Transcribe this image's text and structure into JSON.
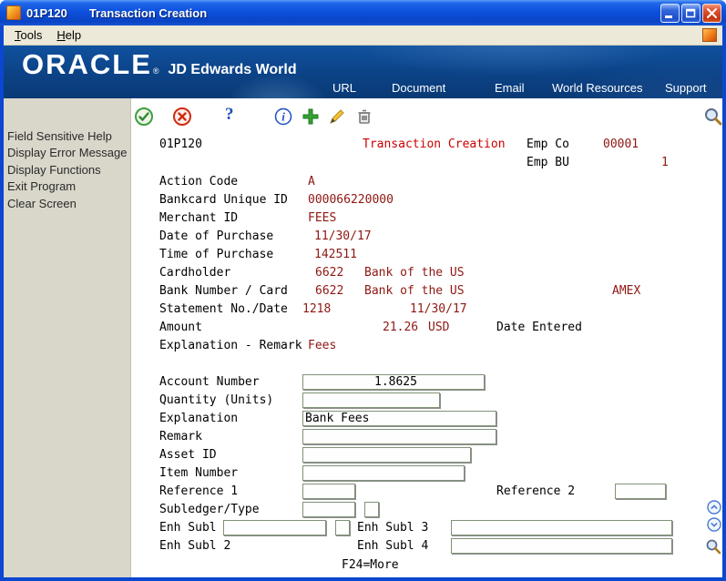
{
  "titlebar": {
    "program": "01P120",
    "title": "Transaction Creation",
    "buttons": [
      "minimize",
      "maximize",
      "close"
    ]
  },
  "menubar": {
    "items": [
      "Tools",
      "Help"
    ]
  },
  "banner": {
    "logo": "ORACLE",
    "trademark": "®",
    "product": "JD Edwards World",
    "links": [
      "URL",
      "Document",
      "Email",
      "World Resources",
      "Support"
    ]
  },
  "sidebar": {
    "items": [
      "Field Sensitive Help",
      "Display Error Message",
      "Display Functions",
      "Exit Program",
      "Clear Screen"
    ]
  },
  "toolbar": {
    "icons": [
      "approve",
      "cancel",
      "help",
      "info",
      "add",
      "edit",
      "delete",
      "search"
    ]
  },
  "screen": {
    "program_id": "01P120",
    "title": "Transaction Creation",
    "emp_co": {
      "label": "Emp Co",
      "value": "00001"
    },
    "emp_bu": {
      "label": "Emp BU",
      "value": "1"
    },
    "rows": {
      "action_code": {
        "label": "Action Code",
        "value": "A"
      },
      "bankcard_id": {
        "label": "Bankcard Unique ID",
        "value": "000066220000"
      },
      "merchant_id": {
        "label": "Merchant ID",
        "value": "FEES"
      },
      "date_of_purchase": {
        "label": "Date of Purchase",
        "value": "11/30/17"
      },
      "time_of_purchase": {
        "label": "Time of Purchase",
        "value": "142511"
      },
      "cardholder": {
        "label": "Cardholder",
        "number": "6622",
        "name": "Bank of the US"
      },
      "bank_number_card": {
        "label": "Bank Number / Card",
        "number": "6622",
        "name": "Bank of the US",
        "card_type": "AMEX"
      },
      "statement": {
        "label": "Statement No./Date",
        "number": "1218",
        "date": "11/30/17"
      },
      "amount": {
        "label": "Amount",
        "value": "21.26",
        "currency": "USD",
        "date_entered_label": "Date Entered"
      },
      "explanation_remark": {
        "label": "Explanation - Remark",
        "value": "Fees"
      }
    },
    "inputs": {
      "account_number": {
        "label": "Account Number",
        "value": "1.8625"
      },
      "quantity": {
        "label": "Quantity (Units)",
        "value": ""
      },
      "explanation": {
        "label": "Explanation",
        "value": "Bank Fees"
      },
      "remark": {
        "label": "Remark",
        "value": ""
      },
      "asset_id": {
        "label": "Asset ID",
        "value": ""
      },
      "item_number": {
        "label": "Item Number",
        "value": ""
      },
      "reference_1": {
        "label": "Reference 1",
        "value": ""
      },
      "reference_2": {
        "label": "Reference 2",
        "value": ""
      },
      "subledger_type": {
        "label": "Subledger/Type",
        "value": "",
        "type_value": ""
      },
      "enh_subl_1": {
        "label": "Enh Subl 1",
        "value": "",
        "value2": ""
      },
      "enh_subl_2": {
        "label": "Enh Subl 2"
      },
      "enh_subl_3": {
        "label": "Enh Subl 3",
        "value": ""
      },
      "enh_subl_4": {
        "label": "Enh Subl 4",
        "value": ""
      }
    },
    "footer": "F24=More"
  },
  "colors": {
    "title_red": "#cc0000",
    "value_red": "#8e1712",
    "titlebar_blue": "#0d50dc",
    "banner_blue": "#0c4286",
    "menubar_beige": "#ece9d8",
    "sidebar_gray": "#d9d6ca"
  }
}
